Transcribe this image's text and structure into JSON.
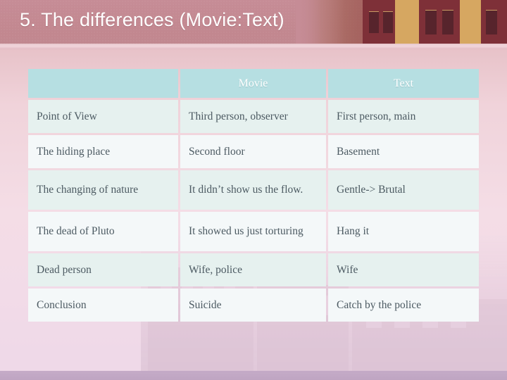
{
  "slide": {
    "title": "5. The differences (Movie:Text)",
    "title_color": "#ffffff",
    "header_band_color": "#c2878f",
    "background_top_color": "#d9aeb5",
    "background_bottom_color": "#efd9e8",
    "bottom_strip_color": "#bca2c0"
  },
  "table": {
    "header_bg_color": "#b6dfe2",
    "header_text_color": "#ffffff",
    "row_odd_bg_color": "#e6f1ef",
    "row_even_bg_color": "#f4f8f9",
    "body_text_color": "#4c5a62",
    "columns": [
      "",
      "Movie",
      "Text"
    ],
    "rows": [
      {
        "aspect": "Point of View",
        "movie": "Third person, observer",
        "text": "First person, main"
      },
      {
        "aspect": "The hiding place",
        "movie": "Second floor",
        "text": "Basement"
      },
      {
        "aspect": "The changing of nature",
        "movie": "It didn’t show us the flow.",
        "text": "Gentle-> Brutal"
      },
      {
        "aspect": "The dead of Pluto",
        "movie": "It showed us just torturing",
        "text": "Hang it"
      },
      {
        "aspect": "Dead person",
        "movie": "Wife, police",
        "text": "Wife"
      },
      {
        "aspect": "Conclusion",
        "movie": "Suicide",
        "text": "Catch by the police"
      }
    ]
  }
}
